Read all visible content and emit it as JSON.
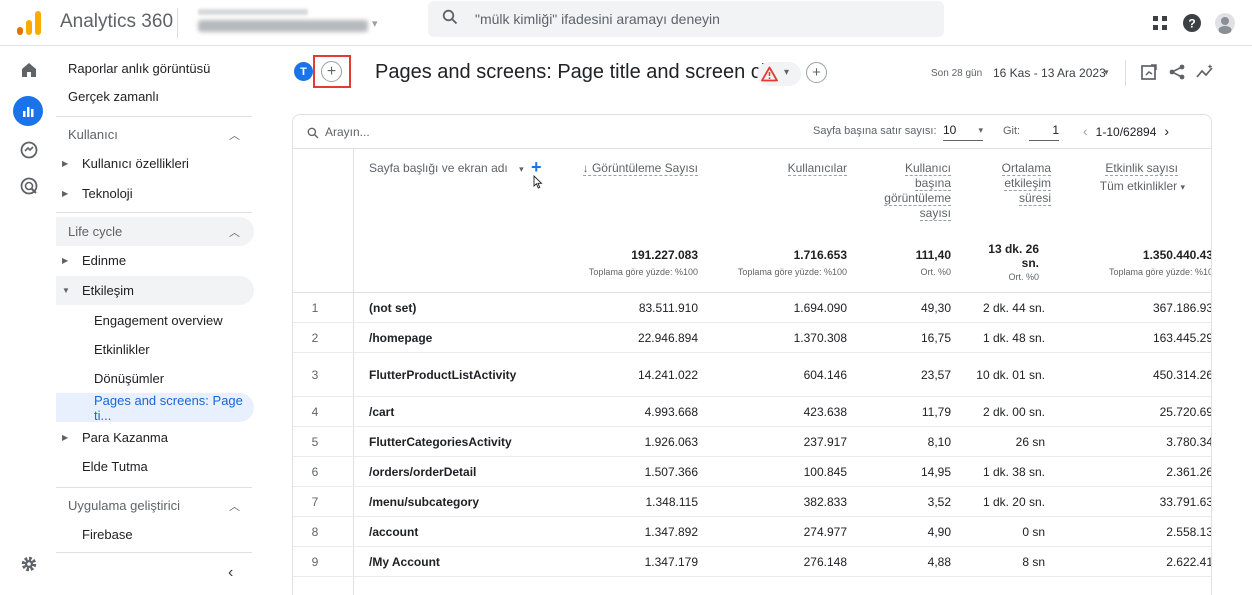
{
  "app": {
    "title": "Analytics 360",
    "search_placeholder": "\"mülk kimliği\" ifadesini aramayı deneyin",
    "brand_colors": {
      "logo_orange": "#f9ab00",
      "logo_dark": "#e37400",
      "accent": "#1a73e8",
      "warning": "#e53935"
    }
  },
  "nav": {
    "items": [
      {
        "label": "Raporlar anlık görüntüsü"
      },
      {
        "label": "Gerçek zamanlı"
      },
      {
        "label": "Kullanıcı"
      },
      {
        "label": "Kullanıcı özellikleri"
      },
      {
        "label": "Teknoloji"
      },
      {
        "label": "Life cycle"
      },
      {
        "label": "Edinme"
      },
      {
        "label": "Etkileşim"
      },
      {
        "label": "Engagement overview"
      },
      {
        "label": "Etkinlikler"
      },
      {
        "label": "Dönüşümler"
      },
      {
        "label": "Pages and screens: Page ti..."
      },
      {
        "label": "Para Kazanma"
      },
      {
        "label": "Elde Tutma"
      },
      {
        "label": "Uygulama geliştirici"
      },
      {
        "label": "Firebase"
      }
    ],
    "collapse_icon": "chevron-left-icon"
  },
  "header": {
    "avatar_letter": "T",
    "title": "Pages and screens: Page title and screen class",
    "date_label": "Son 28 gün",
    "date_range": "16 Kas - 13 Ara 2023"
  },
  "table": {
    "search_placeholder": "Arayın...",
    "rows_per_page_label": "Sayfa başına satır sayısı:",
    "rows_per_page": "10",
    "goto_label": "Git:",
    "goto_value": "1",
    "pagination": "1-10/62894",
    "dimension_header": "Sayfa başlığı ve ekran adı",
    "columns": [
      {
        "label": "↓ Görüntüleme Sayısı",
        "total": "191.227.083",
        "sub": "Toplama göre yüzde: %100"
      },
      {
        "label": "Kullanıcılar",
        "total": "1.716.653",
        "sub": "Toplama göre yüzde: %100"
      },
      {
        "label": "Kullanıcı başına görüntüleme sayısı",
        "total": "111,40",
        "sub": "Ort. %0"
      },
      {
        "label": "Ortalama etkileşim süresi",
        "total": "13 dk. 26 sn.",
        "sub": "Ort. %0"
      },
      {
        "label": "Etkinlik sayısı",
        "label2": "Tüm etkinlikler",
        "total": "1.350.440.43",
        "sub": "Toplama göre yüzde: %10"
      }
    ],
    "rows": [
      {
        "idx": "1",
        "name": "(not set)",
        "views": "83.511.910",
        "users": "1.694.090",
        "vpu": "49,30",
        "dur": "2 dk. 44 sn.",
        "events": "367.186.93"
      },
      {
        "idx": "2",
        "name": "/homepage",
        "views": "22.946.894",
        "users": "1.370.308",
        "vpu": "16,75",
        "dur": "1 dk. 48 sn.",
        "events": "163.445.29"
      },
      {
        "idx": "3",
        "name": "FlutterProductListActivity",
        "views": "14.241.022",
        "users": "604.146",
        "vpu": "23,57",
        "dur": "10 dk. 01 sn.",
        "events": "450.314.26"
      },
      {
        "idx": "4",
        "name": "/cart",
        "views": "4.993.668",
        "users": "423.638",
        "vpu": "11,79",
        "dur": "2 dk. 00 sn.",
        "events": "25.720.69"
      },
      {
        "idx": "5",
        "name": "FlutterCategoriesActivity",
        "views": "1.926.063",
        "users": "237.917",
        "vpu": "8,10",
        "dur": "26 sn",
        "events": "3.780.34"
      },
      {
        "idx": "6",
        "name": "/orders/orderDetail",
        "views": "1.507.366",
        "users": "100.845",
        "vpu": "14,95",
        "dur": "1 dk. 38 sn.",
        "events": "2.361.26"
      },
      {
        "idx": "7",
        "name": "/menu/subcategory",
        "views": "1.348.115",
        "users": "382.833",
        "vpu": "3,52",
        "dur": "1 dk. 20 sn.",
        "events": "33.791.63"
      },
      {
        "idx": "8",
        "name": "/account",
        "views": "1.347.892",
        "users": "274.977",
        "vpu": "4,90",
        "dur": "0 sn",
        "events": "2.558.13"
      },
      {
        "idx": "9",
        "name": "/My Account",
        "views": "1.347.179",
        "users": "276.148",
        "vpu": "4,88",
        "dur": "8 sn",
        "events": "2.622.41"
      }
    ]
  }
}
